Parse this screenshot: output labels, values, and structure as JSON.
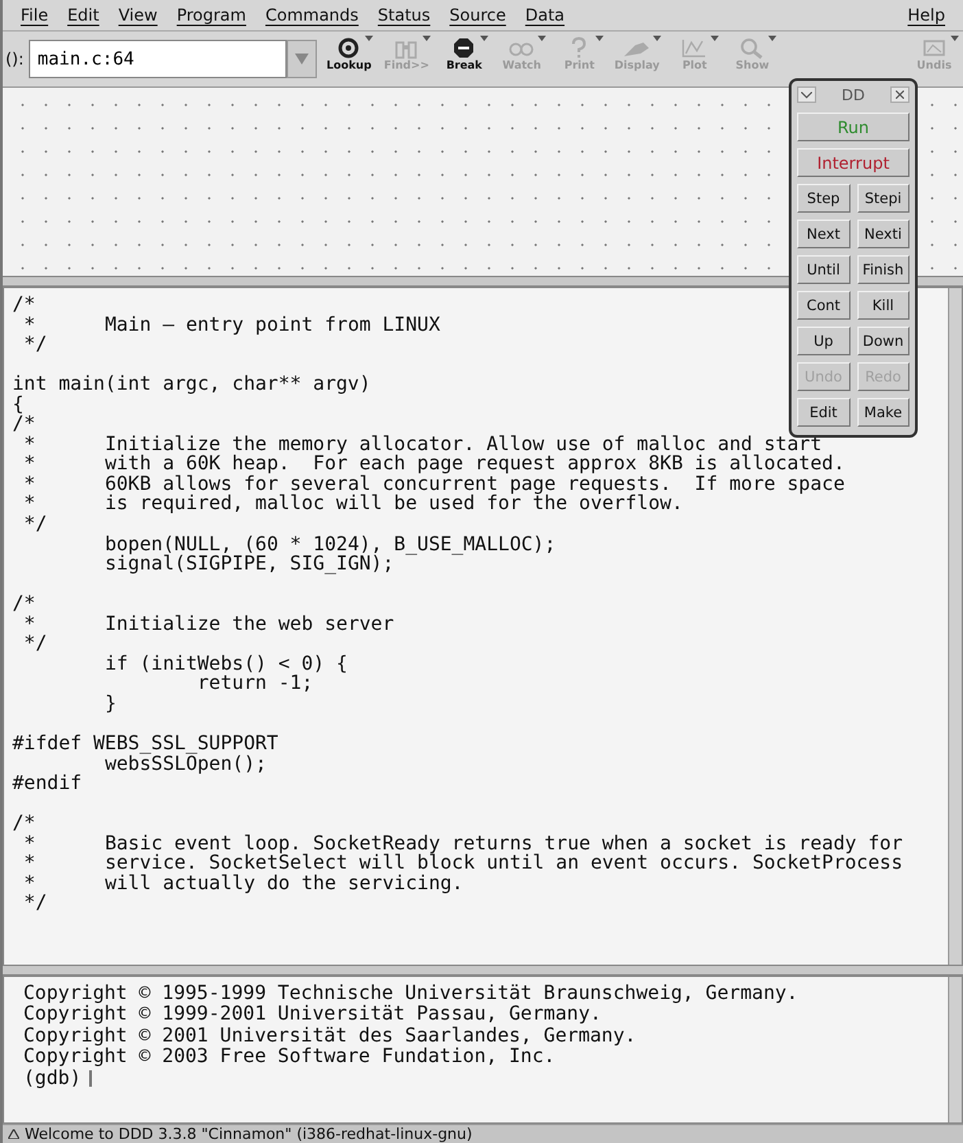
{
  "menu_bar": {
    "items": [
      {
        "label": "File"
      },
      {
        "label": "Edit"
      },
      {
        "label": "View"
      },
      {
        "label": "Program"
      },
      {
        "label": "Commands"
      },
      {
        "label": "Status"
      },
      {
        "label": "Source"
      },
      {
        "label": "Data"
      }
    ],
    "help": "Help"
  },
  "toolbar": {
    "argument_label": "():",
    "argument": {
      "value": "main.c:64"
    },
    "buttons": [
      {
        "label": "Lookup",
        "disabled": false
      },
      {
        "label": "Find>>",
        "disabled": true
      },
      {
        "label": "Break",
        "disabled": false
      },
      {
        "label": "Watch",
        "disabled": true
      },
      {
        "label": "Print",
        "disabled": true
      },
      {
        "label": "Display",
        "disabled": true
      },
      {
        "label": "Plot",
        "disabled": true
      },
      {
        "label": "Show",
        "disabled": true
      },
      {
        "label": "Undis",
        "disabled": true
      }
    ]
  },
  "command_tool": {
    "title": "DD",
    "buttons": [
      {
        "label": "Run",
        "kind": "wide",
        "color": "#2e8b2e",
        "disabled": false
      },
      {
        "label": "Interrupt",
        "kind": "wide",
        "color": "#b02030",
        "disabled": false
      },
      {
        "label": "Step",
        "kind": "half",
        "disabled": false
      },
      {
        "label": "Stepi",
        "kind": "half",
        "disabled": false
      },
      {
        "label": "Next",
        "kind": "half",
        "disabled": false
      },
      {
        "label": "Nexti",
        "kind": "half",
        "disabled": false
      },
      {
        "label": "Until",
        "kind": "half",
        "disabled": false
      },
      {
        "label": "Finish",
        "kind": "half",
        "disabled": false
      },
      {
        "label": "Cont",
        "kind": "half",
        "disabled": false
      },
      {
        "label": "Kill",
        "kind": "half",
        "disabled": false
      },
      {
        "label": "Up",
        "kind": "half",
        "disabled": false
      },
      {
        "label": "Down",
        "kind": "half",
        "disabled": false
      },
      {
        "label": "Undo",
        "kind": "half",
        "disabled": true
      },
      {
        "label": "Redo",
        "kind": "half",
        "disabled": true
      },
      {
        "label": "Edit",
        "kind": "half",
        "disabled": false
      },
      {
        "label": "Make",
        "kind": "half",
        "disabled": false
      }
    ]
  },
  "source": {
    "blocks": [
      {
        "lines": [
          "/*",
          " *\tMain — entry point from LINUX",
          " */"
        ]
      },
      {
        "lines": [
          "int main(int argc, char** argv)",
          "{",
          "/*",
          " *\tInitialize the memory allocator. Allow use of malloc and start",
          " *\twith a 60K heap.  For each page request approx 8KB is allocated.",
          " *\t60KB allows for several concurrent page requests.  If more space",
          " *\tis required, malloc will be used for the overflow.",
          " */",
          "\tbopen(NULL, (60 * 1024), B_USE_MALLOC);",
          "\tsignal(SIGPIPE, SIG_IGN);"
        ]
      },
      {
        "lines": [
          "/*",
          " *\tInitialize the web server",
          " */",
          "\tif (initWebs() < 0) {",
          "\t\treturn -1;",
          "\t}"
        ]
      },
      {
        "lines": [
          "#ifdef WEBS_SSL_SUPPORT",
          "\twebsSSLOpen();",
          "#endif"
        ]
      },
      {
        "lines": [
          "/*",
          " *\tBasic event loop. SocketReady returns true when a socket is ready for",
          " *\tservice. SocketSelect will block until an event occurs. SocketProcess",
          " *\twill actually do the servicing.",
          " */"
        ]
      }
    ]
  },
  "console": {
    "lines": [
      "Copyright © 1995-1999 Technische Universität Braunschweig, Germany.",
      "Copyright © 1999-2001 Universität Passau, Germany.",
      "Copyright © 2001 Universität des Saarlandes, Germany.",
      "Copyright © 2003 Free Software Fundation, Inc."
    ],
    "prompt": "(gdb)"
  },
  "status_bar": {
    "message": "Welcome to DDD 3.3.8 \"Cinnamon\" (i386-redhat-linux-gnu)"
  }
}
